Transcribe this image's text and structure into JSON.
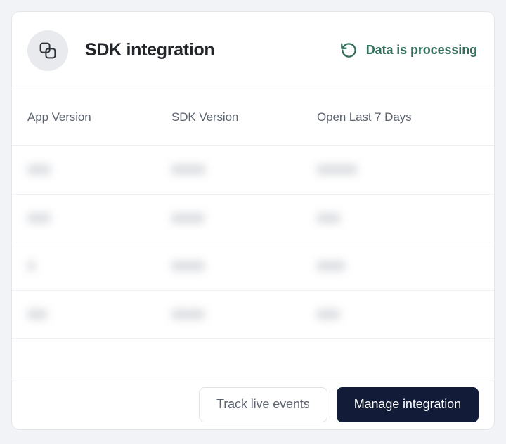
{
  "card": {
    "header": {
      "icon": "copy-stack-icon",
      "title": "SDK integration",
      "status": {
        "icon": "rotate-ccw-icon",
        "label": "Data is processing",
        "color": "#34705a"
      }
    },
    "table": {
      "columns": [
        {
          "key": "app_version",
          "label": "App Version"
        },
        {
          "key": "sdk_version",
          "label": "SDK Version"
        },
        {
          "key": "open_last_7_days",
          "label": "Open Last 7 Days"
        }
      ],
      "rows": [
        {
          "app_version": "",
          "sdk_version": "",
          "open_last_7_days": "",
          "redacted": true,
          "widths": [
            33,
            48,
            57
          ]
        },
        {
          "app_version": "",
          "sdk_version": "",
          "open_last_7_days": "",
          "redacted": true,
          "widths": [
            33,
            47,
            33
          ]
        },
        {
          "app_version": "",
          "sdk_version": "",
          "open_last_7_days": "",
          "redacted": true,
          "widths": [
            11,
            47,
            40
          ]
        },
        {
          "app_version": "",
          "sdk_version": "",
          "open_last_7_days": "",
          "redacted": true,
          "widths": [
            28,
            47,
            33
          ]
        }
      ]
    },
    "footer": {
      "secondary_button": "Track live events",
      "primary_button": "Manage integration",
      "primary_color": "#121c38"
    }
  },
  "theme": {
    "page_background": "#f1f3f6",
    "card_background": "#ffffff",
    "border": "#e3e6ea",
    "title_color": "#22252a",
    "muted_text": "#5d6470"
  }
}
